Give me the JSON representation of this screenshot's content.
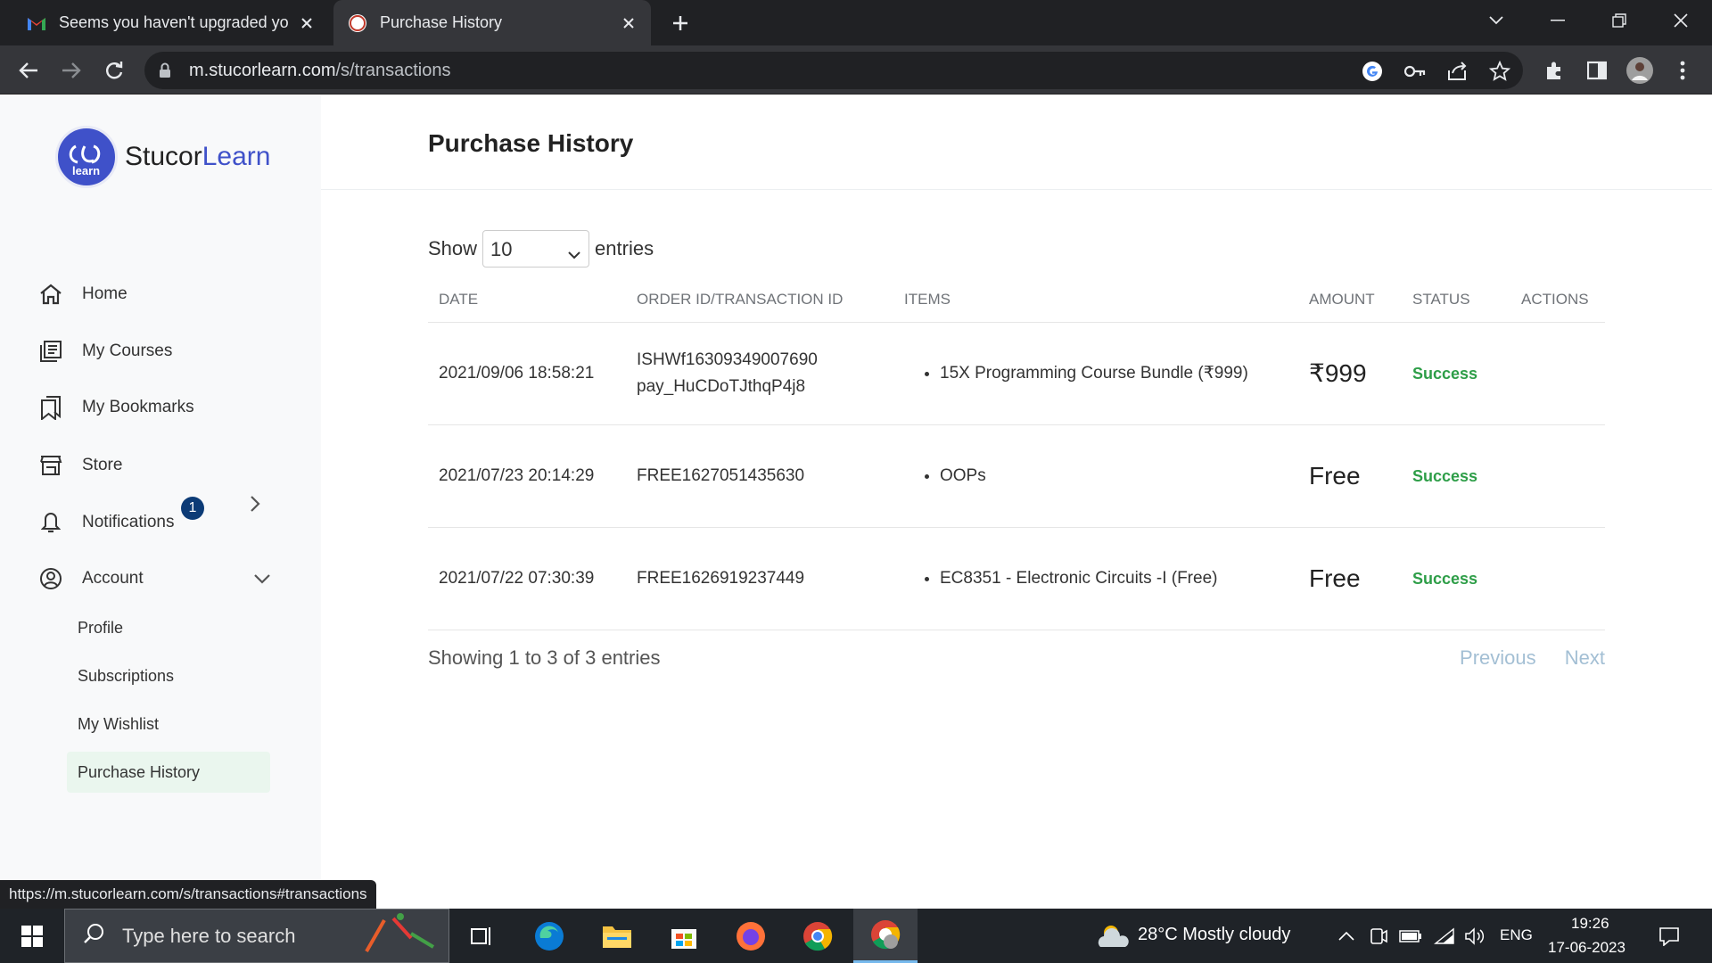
{
  "browser": {
    "tabs": [
      {
        "title": "Seems you haven't upgraded yo",
        "active": false,
        "favicon": "gmail-icon"
      },
      {
        "title": "Purchase History",
        "active": true,
        "favicon": "stucor-icon"
      }
    ],
    "url_domain": "m.stucorlearn.com",
    "url_path": "/s/transactions"
  },
  "sidebar": {
    "logo_name_part1": "Stucor",
    "logo_name_part2": "Learn",
    "logo_badge_text": "learn",
    "items": [
      {
        "label": "Home",
        "icon": "home-icon"
      },
      {
        "label": "My Courses",
        "icon": "courses-icon"
      },
      {
        "label": "My Bookmarks",
        "icon": "bookmark-icon"
      },
      {
        "label": "Store",
        "icon": "store-icon"
      },
      {
        "label": "Notifications",
        "icon": "bell-icon"
      },
      {
        "label": "Account",
        "icon": "account-icon"
      }
    ],
    "notification_count": "1",
    "account_sub": [
      "Profile",
      "Subscriptions",
      "My Wishlist",
      "Purchase History"
    ]
  },
  "page": {
    "title": "Purchase History",
    "show_label": "Show",
    "entries_value": "10",
    "entries_label": "entries",
    "columns": [
      "DATE",
      "ORDER ID/TRANSACTION ID",
      "ITEMS",
      "AMOUNT",
      "STATUS",
      "ACTIONS"
    ],
    "rows": [
      {
        "date": "2021/09/06 18:58:21",
        "order_id": "ISHWf16309349007690",
        "txn_id": "pay_HuCDoTJthqP4j8",
        "item": "15X Programming Course Bundle (₹999)",
        "amount": "₹999",
        "status": "Success"
      },
      {
        "date": "2021/07/23 20:14:29",
        "order_id": "FREE1627051435630",
        "txn_id": "",
        "item": "OOPs",
        "amount": "Free",
        "status": "Success"
      },
      {
        "date": "2021/07/22 07:30:39",
        "order_id": "FREE1626919237449",
        "txn_id": "",
        "item": "EC8351 - Electronic Circuits -I (Free)",
        "amount": "Free",
        "status": "Success"
      }
    ],
    "showing_text": "Showing 1 to 3 of 3 entries",
    "prev_label": "Previous",
    "next_label": "Next"
  },
  "status_url": "https://m.stucorlearn.com/s/transactions#transactions",
  "taskbar": {
    "search_placeholder": "Type here to search",
    "weather": "28°C  Mostly cloudy",
    "lang": "ENG",
    "time": "19:26",
    "date": "17-06-2023"
  },
  "colors": {
    "accent": "#3f51c9",
    "success": "#2e9e48",
    "badge": "#0c3b76"
  }
}
